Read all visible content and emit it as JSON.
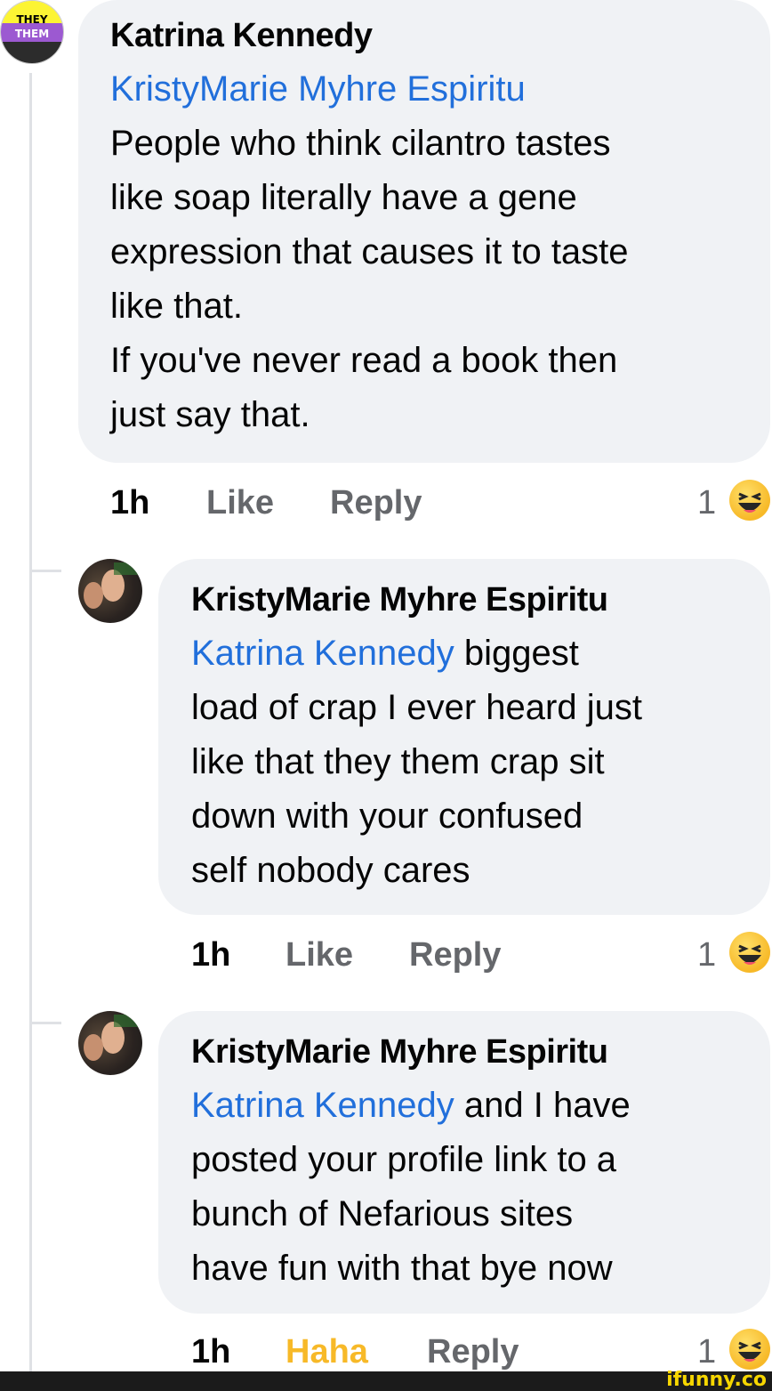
{
  "badge": {
    "line1": "THEY",
    "line2": "THEM"
  },
  "comments": [
    {
      "author": "Katrina Kennedy",
      "mention": "KristyMarie Myhre Espiritu",
      "text_lines": [
        "People who think cilantro tastes",
        "like soap literally have a gene",
        "expression that causes it to taste",
        "like that.",
        "If you've never read a book then",
        "just say that."
      ],
      "time": "1h",
      "like_label": "Like",
      "reply_label": "Reply",
      "reaction_count": "1"
    },
    {
      "author": "KristyMarie Myhre Espiritu",
      "mention": "Katrina Kennedy",
      "first_line_rest": " biggest",
      "text_lines": [
        "load of crap I ever heard just",
        "like that they them crap sit",
        "down with your confused",
        "self nobody cares"
      ],
      "time": "1h",
      "like_label": "Like",
      "reply_label": "Reply",
      "reaction_count": "1"
    },
    {
      "author": "KristyMarie Myhre Espiritu",
      "mention": "Katrina Kennedy",
      "first_line_rest": " and I have",
      "text_lines": [
        "posted your profile link to a",
        "bunch of Nefarious sites",
        "have fun with that bye now"
      ],
      "time": "1h",
      "like_label": "Haha",
      "reply_label": "Reply",
      "reaction_count": "1"
    }
  ],
  "reaction_icon": "haha-emoji-icon",
  "watermark": "ifunny.co",
  "colors": {
    "mention": "#216fdb",
    "bubble": "#f0f2f5",
    "muted": "#65676b",
    "haha": "#f7b928"
  }
}
